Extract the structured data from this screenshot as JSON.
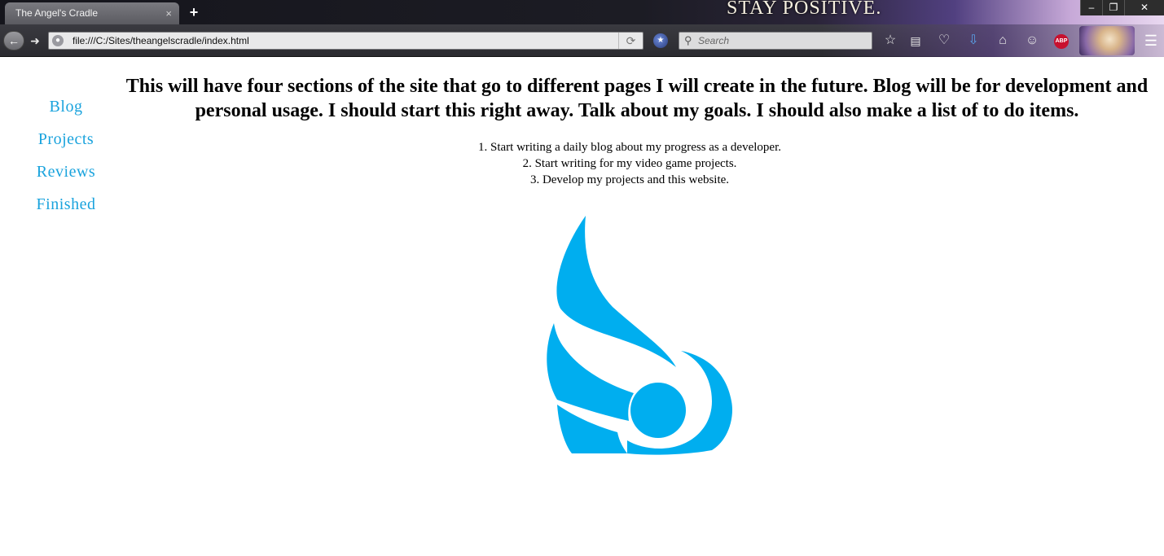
{
  "browser": {
    "tab_title": "The Angel's Cradle",
    "tab_close": "×",
    "new_tab": "+",
    "theme_banner": "STAY POSITIVE.",
    "window_controls": {
      "minimize": "‒",
      "restore": "❐",
      "close": "✕"
    },
    "url": "file:///C:/Sites/theangelscradle/index.html",
    "search_placeholder": "Search",
    "adblock_label": "ABP",
    "icons": [
      "back-icon",
      "forward-icon",
      "globe-icon",
      "reload-icon",
      "search-icon",
      "star-icon",
      "reading-list-icon",
      "pocket-icon",
      "download-icon",
      "home-icon",
      "smiley-icon",
      "adblock-icon",
      "menu-icon"
    ]
  },
  "colors": {
    "link": "#1aa3dd",
    "logo": "#00aeef"
  },
  "sidebar": {
    "items": [
      {
        "label": "Blog"
      },
      {
        "label": "Projects"
      },
      {
        "label": "Reviews"
      },
      {
        "label": "Finished"
      }
    ]
  },
  "main": {
    "heading": "This will have four sections of the site that go to different pages I will create in the future. Blog will be for development and personal usage. I should start this right away. Talk about my goals. I should also make a list of to do items.",
    "todo": [
      "1. Start writing a daily blog about my progress as a developer.",
      "2. Start writing for my video game projects.",
      "3. Develop my projects and this website."
    ]
  }
}
